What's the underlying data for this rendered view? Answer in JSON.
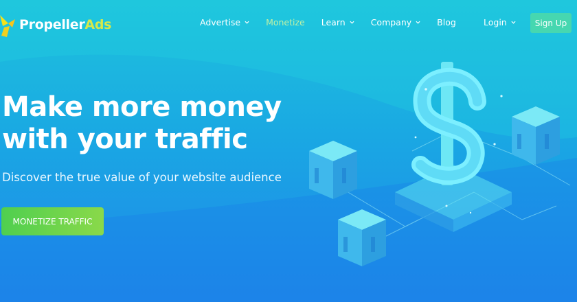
{
  "brand": {
    "name_part1": "Propeller",
    "name_part2": "Ads",
    "logo_icon": "propeller-icon"
  },
  "nav": {
    "items": [
      {
        "label": "Advertise",
        "dropdown": true
      },
      {
        "label": "Monetize",
        "dropdown": false,
        "active": true
      },
      {
        "label": "Learn",
        "dropdown": true
      },
      {
        "label": "Company",
        "dropdown": true
      },
      {
        "label": "Blog",
        "dropdown": false
      }
    ],
    "login": "Login",
    "signup": "Sign Up"
  },
  "hero": {
    "title_line1": "Make more money",
    "title_line2": "with your traffic",
    "subtitle": "Discover the true value of your website audience",
    "cta": "MONETIZE TRAFFIC"
  },
  "colors": {
    "accent_green": "#8ad94a",
    "signup_bg": "#46d7b0",
    "logo_yellow": "#d6e94a",
    "active_nav": "#bff2a6"
  },
  "illustration": {
    "icon": "dollar-sign-icon",
    "blocks": "server-cube-icon"
  }
}
